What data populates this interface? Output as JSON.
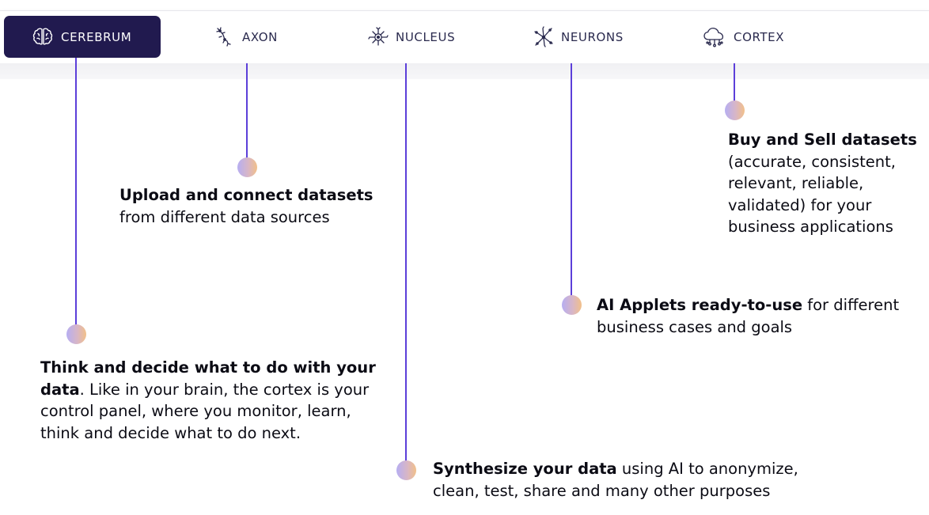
{
  "nav": {
    "tabs": [
      {
        "label": "CEREBRUM",
        "icon": "brain-icon",
        "active": true
      },
      {
        "label": "AXON",
        "icon": "axon-icon",
        "active": false
      },
      {
        "label": "NUCLEUS",
        "icon": "nucleus-icon",
        "active": false
      },
      {
        "label": "NEURONS",
        "icon": "neurons-network-icon",
        "active": false
      },
      {
        "label": "CORTEX",
        "icon": "cloud-network-icon",
        "active": false
      }
    ]
  },
  "features": {
    "axon": {
      "bold": "Upload and connect datasets",
      "text": "from different data sources"
    },
    "cortex": {
      "bold": "Buy and Sell datasets",
      "text": "(accurate, consistent, relevant, reliable, validated) for your business applications"
    },
    "neurons": {
      "bold": "AI Applets ready-to-use",
      "text": " for different business cases and goals"
    },
    "cerebrum": {
      "bold": "Think and decide what to do with your data",
      "text": ". Like in your brain, the cortex is your control panel, where you monitor, learn, think and decide what to do next."
    },
    "nucleus": {
      "bold": "Synthesize your data",
      "text": " using AI to anonymize, clean, test, share and many other purposes"
    }
  },
  "colors": {
    "active_tab_bg": "#211a4f",
    "line": "#5c3fd9",
    "dot_gradient_start": "#b6aef2",
    "dot_gradient_end": "#f2c089"
  }
}
